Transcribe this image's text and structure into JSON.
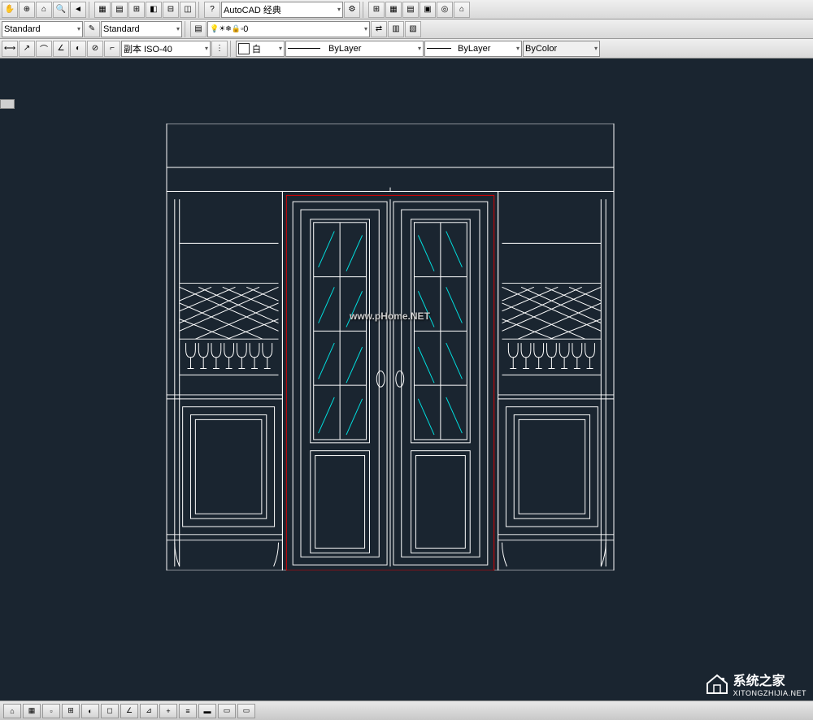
{
  "toolbars": {
    "workspace": "AutoCAD 经典",
    "textStyle1": "Standard",
    "textStyle2": "Standard",
    "dimStyle": "副本 ISO-40",
    "layerValue": "0",
    "colorLabel": "白",
    "linetype": "ByLayer",
    "lineweight": "ByLayer",
    "plotStyle": "ByColor"
  },
  "watermarks": {
    "center": "www.pHome.NET",
    "brand": "系统之家",
    "brandUrl": "XITONGZHIJIA.NET"
  }
}
